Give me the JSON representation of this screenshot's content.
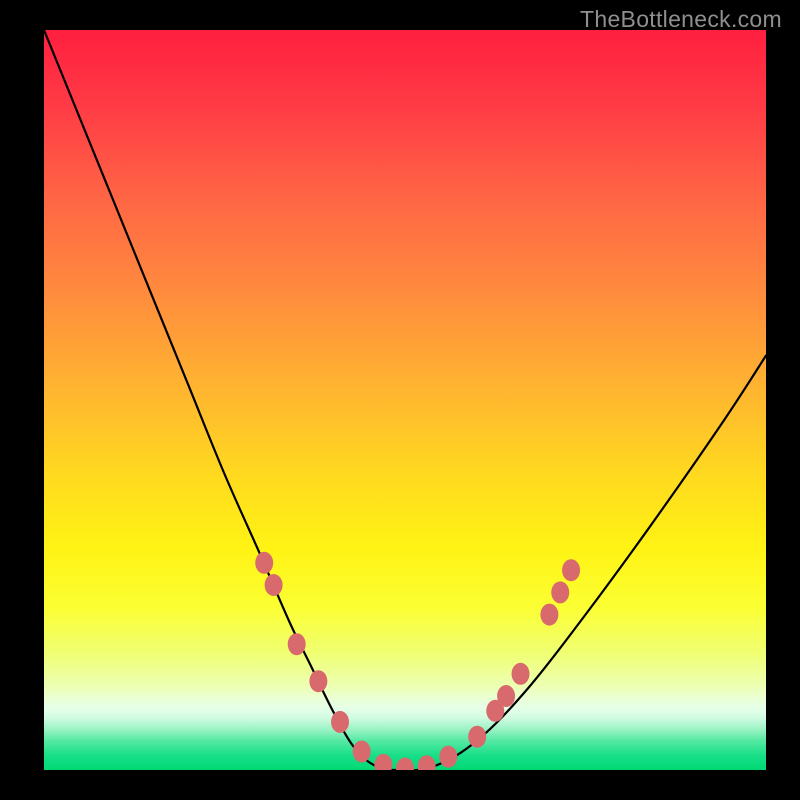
{
  "watermark": "TheBottleneck.com",
  "chart_data": {
    "type": "line",
    "title": "",
    "xlabel": "",
    "ylabel": "",
    "xlim": [
      0,
      100
    ],
    "ylim": [
      0,
      100
    ],
    "series": [
      {
        "name": "bottleneck-curve",
        "x": [
          0,
          5,
          10,
          15,
          20,
          25,
          30,
          34,
          37,
          40,
          43,
          46,
          49,
          54,
          60,
          67,
          75,
          84,
          94,
          100
        ],
        "y": [
          100,
          88,
          76,
          64,
          52,
          40,
          29,
          20,
          14,
          8,
          3,
          0.5,
          0,
          0.5,
          4,
          11,
          21,
          33,
          47,
          56
        ]
      }
    ],
    "markers": {
      "name": "highlight-dots",
      "color": "#d86a6e",
      "points": [
        {
          "x": 30.5,
          "y": 28
        },
        {
          "x": 31.8,
          "y": 25
        },
        {
          "x": 35.0,
          "y": 17
        },
        {
          "x": 38.0,
          "y": 12
        },
        {
          "x": 41.0,
          "y": 6.5
        },
        {
          "x": 44.0,
          "y": 2.5
        },
        {
          "x": 47.0,
          "y": 0.7
        },
        {
          "x": 50.0,
          "y": 0.2
        },
        {
          "x": 53.0,
          "y": 0.5
        },
        {
          "x": 56.0,
          "y": 1.8
        },
        {
          "x": 60.0,
          "y": 4.5
        },
        {
          "x": 62.5,
          "y": 8
        },
        {
          "x": 64.0,
          "y": 10
        },
        {
          "x": 66.0,
          "y": 13
        },
        {
          "x": 70.0,
          "y": 21
        },
        {
          "x": 71.5,
          "y": 24
        },
        {
          "x": 73.0,
          "y": 27
        }
      ]
    },
    "gradient_stops": [
      {
        "offset": 0.0,
        "color": "#ff1f3f"
      },
      {
        "offset": 0.1,
        "color": "#ff3a45"
      },
      {
        "offset": 0.22,
        "color": "#ff6345"
      },
      {
        "offset": 0.35,
        "color": "#ff8a3e"
      },
      {
        "offset": 0.48,
        "color": "#ffb331"
      },
      {
        "offset": 0.6,
        "color": "#ffd91f"
      },
      {
        "offset": 0.7,
        "color": "#fff314"
      },
      {
        "offset": 0.78,
        "color": "#fbff33"
      },
      {
        "offset": 0.84,
        "color": "#f0ff70"
      },
      {
        "offset": 0.885,
        "color": "#ecffb0"
      },
      {
        "offset": 0.905,
        "color": "#eaffd8"
      },
      {
        "offset": 0.918,
        "color": "#e4ffe8"
      },
      {
        "offset": 0.93,
        "color": "#cffbe2"
      },
      {
        "offset": 0.945,
        "color": "#9bf3c4"
      },
      {
        "offset": 0.96,
        "color": "#57e9a4"
      },
      {
        "offset": 0.98,
        "color": "#19df88"
      },
      {
        "offset": 1.0,
        "color": "#00d974"
      }
    ]
  }
}
